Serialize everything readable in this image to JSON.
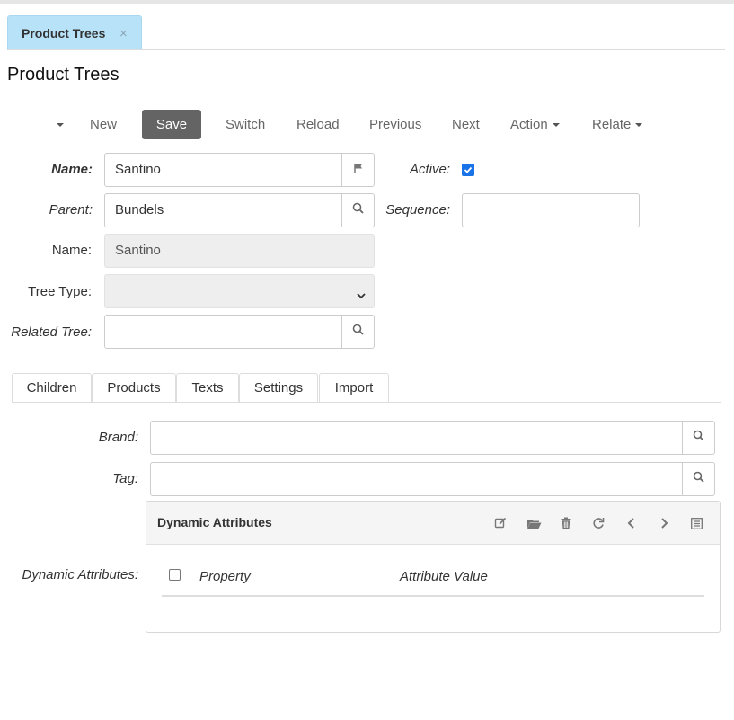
{
  "doc_tab": {
    "label": "Product Trees",
    "close_glyph": "×"
  },
  "page_title": "Product Trees",
  "toolbar": {
    "new": "New",
    "save": "Save",
    "switch": "Switch",
    "reload": "Reload",
    "previous": "Previous",
    "next": "Next",
    "action": "Action",
    "relate": "Relate"
  },
  "form": {
    "name_label": "Name:",
    "name_value": "Santino",
    "active_label": "Active:",
    "active_checked": true,
    "parent_label": "Parent:",
    "parent_value": "Bundels",
    "sequence_label": "Sequence:",
    "sequence_value": "",
    "name2_label": "Name:",
    "name2_value": "Santino",
    "tree_type_label": "Tree Type:",
    "tree_type_value": "",
    "related_tree_label": "Related Tree:",
    "related_tree_value": ""
  },
  "subtabs": [
    "Children",
    "Products",
    "Texts",
    "Settings",
    "Import"
  ],
  "settings": {
    "brand_label": "Brand:",
    "brand_value": "",
    "tag_label": "Tag:",
    "tag_value": "",
    "dyn_label": "Dynamic Attributes:"
  },
  "panel": {
    "title": "Dynamic Attributes",
    "columns": [
      "Property",
      "Attribute Value"
    ],
    "icons": [
      "edit-icon",
      "folder-open-icon",
      "trash-icon",
      "refresh-icon",
      "chevron-left-icon",
      "chevron-right-icon",
      "list-icon"
    ]
  },
  "colors": {
    "tab_bg": "#b8e2f8",
    "save_bg": "#646464",
    "checkbox": "#1a73e8"
  }
}
